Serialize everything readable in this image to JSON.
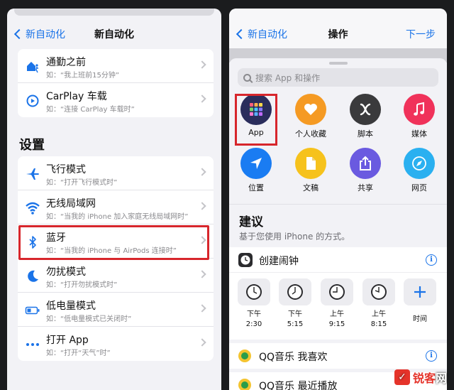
{
  "left": {
    "back_label": "新自动化",
    "nav_title": "新自动化",
    "top_items": [
      {
        "title": "通勤之前",
        "subtitle": "如：“我上班前15分钟”",
        "icon": "home-walk-icon"
      },
      {
        "title": "CarPlay 车载",
        "subtitle": "如：“连接 CarPlay 车载时”",
        "icon": "carplay-icon"
      }
    ],
    "section_title": "设置",
    "settings_items": [
      {
        "title": "飞行模式",
        "subtitle": "如：“打开飞行模式时”",
        "icon": "airplane-icon"
      },
      {
        "title": "无线局域网",
        "subtitle": "如：“当我的 iPhone 加入家庭无线局域网时”",
        "icon": "wifi-icon"
      },
      {
        "title": "蓝牙",
        "subtitle": "如：“当我的 iPhone 与 AirPods 连接时”",
        "icon": "bluetooth-icon"
      },
      {
        "title": "勿扰模式",
        "subtitle": "如：“打开勿扰模式时”",
        "icon": "moon-icon"
      },
      {
        "title": "低电量模式",
        "subtitle": "如：“低电量模式已关闭时”",
        "icon": "battery-icon"
      },
      {
        "title": "打开 App",
        "subtitle": "如：“打开“天气”时”",
        "icon": "ellipsis-icon"
      }
    ]
  },
  "right": {
    "back_label": "新自动化",
    "nav_title": "操作",
    "next_label": "下一步",
    "search_placeholder": "搜索 App 和操作",
    "categories": [
      {
        "label": "App",
        "icon": "apps-grid-icon",
        "color": "#2a2d5c"
      },
      {
        "label": "个人收藏",
        "icon": "heart-icon",
        "color": "#f59a23"
      },
      {
        "label": "脚本",
        "icon": "script-x-icon",
        "color": "#3a3a3c"
      },
      {
        "label": "媒体",
        "icon": "music-note-icon",
        "color": "#f0325a"
      },
      {
        "label": "位置",
        "icon": "location-arrow-icon",
        "color": "#1a7cf2"
      },
      {
        "label": "文稿",
        "icon": "document-icon",
        "color": "#f6c21c"
      },
      {
        "label": "共享",
        "icon": "share-icon",
        "color": "#6a5ae0"
      },
      {
        "label": "网页",
        "icon": "compass-icon",
        "color": "#2ab0f0"
      }
    ],
    "suggestions_title": "建议",
    "suggestions_subtitle": "基于您使用 iPhone 的方式。",
    "card1": {
      "name": "创建闹钟",
      "clocks": [
        {
          "line1": "下午",
          "line2": "2:30"
        },
        {
          "line1": "下午",
          "line2": "5:15"
        },
        {
          "line1": "上午",
          "line2": "9:15"
        },
        {
          "line1": "上午",
          "line2": "8:15"
        }
      ],
      "add_label": "时间"
    },
    "card2": {
      "name": "QQ音乐 我喜欢"
    },
    "card3": {
      "name": "QQ音乐 最近播放"
    }
  },
  "watermark": {
    "text_a": "锐客",
    "text_b": "网"
  }
}
